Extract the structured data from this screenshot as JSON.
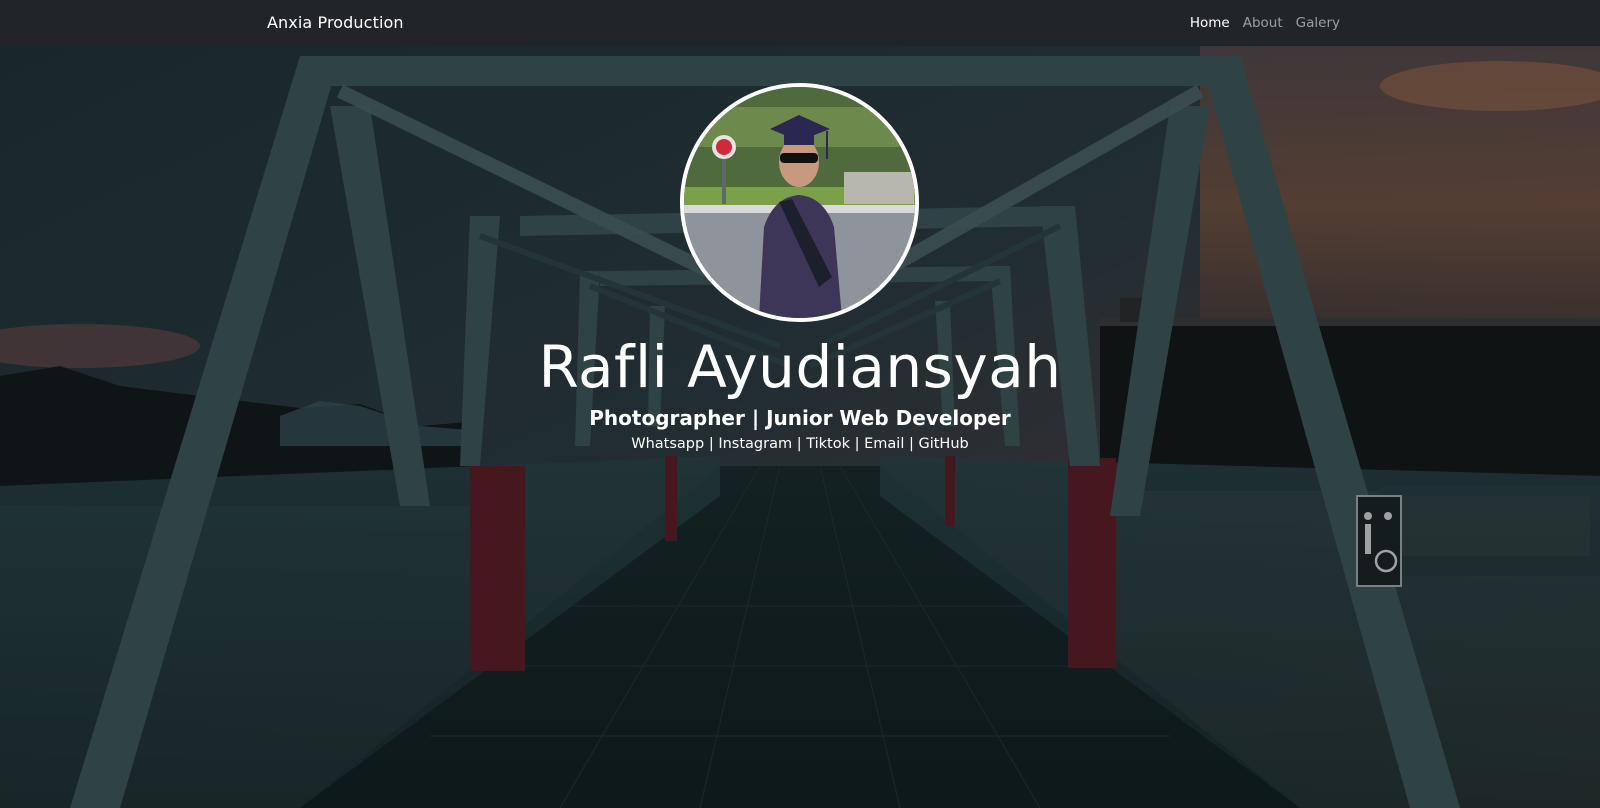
{
  "navbar": {
    "brand": "Anxia Production",
    "links": [
      {
        "label": "Home",
        "active": true
      },
      {
        "label": "About",
        "active": false
      },
      {
        "label": "Galery",
        "active": false
      }
    ]
  },
  "hero": {
    "name": "Rafli Ayudiansyah",
    "role": "Photographer | Junior Web Developer",
    "social_links": [
      "Whatsapp",
      "Instagram",
      "Tiktok",
      "Email",
      "GitHub"
    ],
    "separator": "|"
  },
  "colors": {
    "navbar_bg": "#212529",
    "text": "#ffffff",
    "nav_inactive": "rgba(255,255,255,0.55)"
  }
}
